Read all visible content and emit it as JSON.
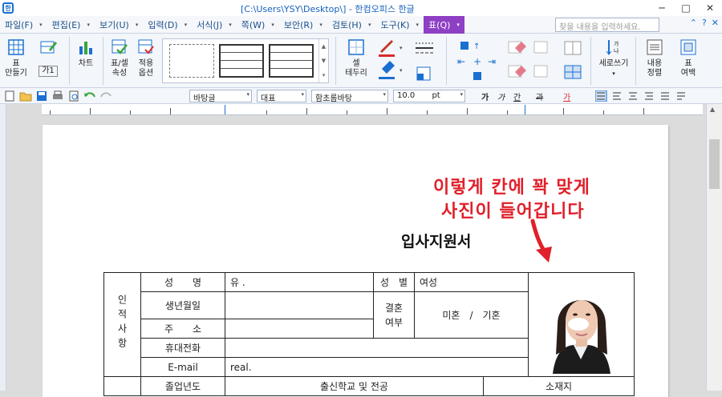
{
  "window": {
    "title": "[C:\\Users\\YSY\\Desktop\\] - 한컴오피스 한글",
    "minimize": "─",
    "maximize": "□",
    "close": "✕"
  },
  "menu": {
    "items": [
      "파일(F)",
      "편집(E)",
      "보기(U)",
      "입력(D)",
      "서식(J)",
      "쪽(W)",
      "보안(R)",
      "검토(H)",
      "도구(K)",
      "표(Q)"
    ],
    "search_placeholder": "찾을 내용을 입력하세요.",
    "right_icons": [
      "⌃",
      "?",
      "✕"
    ]
  },
  "ribbon": {
    "table_make": "표\n만들기",
    "ga1": "가1",
    "chart": "차트",
    "cell_props": "표/셀\n속성",
    "apply_opts": "적용\n옵션",
    "cell_border": "셀\n테두리",
    "vertical_write": "세로쓰기",
    "content_align": "내용\n정렬",
    "table_margin": "표\n여백"
  },
  "toolbar2": {
    "style": "바탕글",
    "para": "대표",
    "font": "함초롬바탕",
    "size": "10.0",
    "unit": "pt",
    "bold": "가",
    "italic": "가",
    "underline": "간",
    "strike": "과",
    "color": "가"
  },
  "annotation": {
    "line1": "이렇게 칸에 꽉 맞게",
    "line2": "사진이 들어갑니다"
  },
  "document": {
    "title": "입사지원서"
  },
  "form": {
    "section_label": "인적사항",
    "rows": [
      {
        "label": "성　　명",
        "value": "유 ."
      },
      {
        "label": "생년월일",
        "value": ""
      },
      {
        "label": "주　　소",
        "value": ""
      },
      {
        "label": "휴대전화",
        "value": ""
      },
      {
        "label": "E-mail",
        "value": "real."
      }
    ],
    "gender_label": "성　별",
    "gender_value": "여성",
    "marriage_label": "결혼\n여부",
    "marriage_value": "미혼　/　기혼",
    "footer_cols": [
      "졸업년도",
      "출신학교 및 전공",
      "소재지"
    ]
  }
}
